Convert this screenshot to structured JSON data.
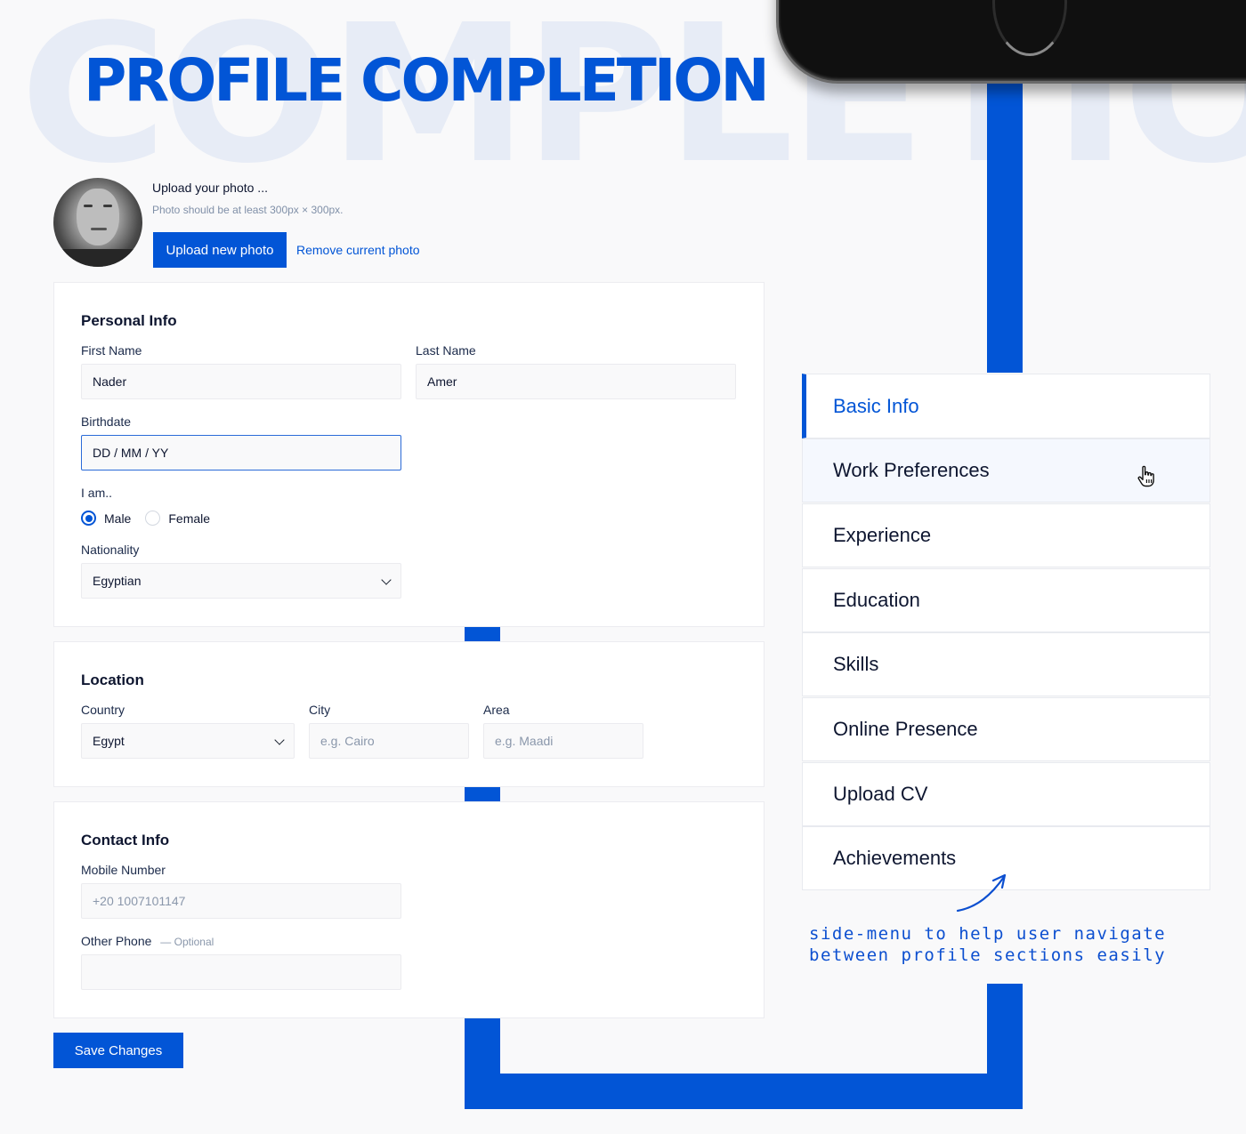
{
  "header": {
    "title": "PROFILE COMPLETION",
    "watermark": "COMPLETION"
  },
  "colors": {
    "accent": "#0255d6",
    "background": "#f9f9fa",
    "watermark": "#e7ecf6"
  },
  "photo": {
    "title": "Upload your photo ...",
    "hint": "Photo should be at least 300px × 300px.",
    "upload_button": "Upload new photo",
    "remove_link": "Remove current photo"
  },
  "personal_info": {
    "title": "Personal Info",
    "first_name": {
      "label": "First Name",
      "value": "Nader"
    },
    "last_name": {
      "label": "Last Name",
      "value": "Amer"
    },
    "birthdate": {
      "label": "Birthdate",
      "value": "DD / MM / YY"
    },
    "gender": {
      "label": "I am..",
      "options": [
        {
          "label": "Male",
          "checked": true
        },
        {
          "label": "Female",
          "checked": false
        }
      ]
    },
    "nationality": {
      "label": "Nationality",
      "value": "Egyptian"
    }
  },
  "location": {
    "title": "Location",
    "country": {
      "label": "Country",
      "value": "Egypt"
    },
    "city": {
      "label": "City",
      "placeholder": "e.g. Cairo"
    },
    "area": {
      "label": "Area",
      "placeholder": "e.g. Maadi"
    }
  },
  "contact_info": {
    "title": "Contact Info",
    "mobile": {
      "label": "Mobile Number",
      "placeholder": "+20 1007101147"
    },
    "other_phone": {
      "label": "Other Phone",
      "optional": "— Optional",
      "value": ""
    }
  },
  "save_button": "Save Changes",
  "side_menu": {
    "items": [
      {
        "label": "Basic Info",
        "state": "active"
      },
      {
        "label": "Work Preferences",
        "state": "hover"
      },
      {
        "label": "Experience",
        "state": ""
      },
      {
        "label": "Education",
        "state": ""
      },
      {
        "label": "Skills",
        "state": ""
      },
      {
        "label": "Online Presence",
        "state": ""
      },
      {
        "label": "Upload CV",
        "state": ""
      },
      {
        "label": "Achievements",
        "state": ""
      }
    ]
  },
  "annotation": {
    "text": "side-menu to help user navigate between profile sections easily"
  }
}
